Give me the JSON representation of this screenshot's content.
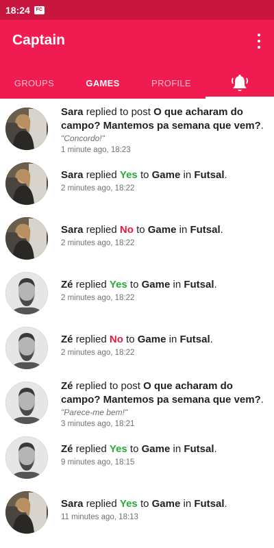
{
  "status_bar": {
    "time": "18:24",
    "notif_label": "FC"
  },
  "app_bar": {
    "title": "Captain"
  },
  "tabs": [
    {
      "label": "GROUPS"
    },
    {
      "label": "GAMES"
    },
    {
      "label": "PROFILE"
    },
    {
      "label": "",
      "icon": "bell-icon"
    }
  ],
  "notifications": [
    {
      "user": "Sara",
      "pre": " replied to post ",
      "post": "O que acharam do campo? Mantemos pa semana que vem?",
      "tail": ".",
      "quote": "\"Concordo!\"",
      "time": "1 minute ago, 18:23"
    },
    {
      "user": "Sara",
      "pre": " replied ",
      "answer": "Yes",
      "mid": " to ",
      "game": "Game",
      "in": " in ",
      "group": "Futsal",
      "tail": ".",
      "time": "2 minutes ago, 18:22"
    },
    {
      "user": "Sara",
      "pre": " replied ",
      "answer": "No",
      "mid": " to ",
      "game": "Game",
      "in": " in ",
      "group": "Futsal",
      "tail": ".",
      "time": "2 minutes ago, 18:22"
    },
    {
      "user": "Zé",
      "pre": " replied ",
      "answer": "Yes",
      "mid": " to ",
      "game": "Game",
      "in": " in ",
      "group": "Futsal",
      "tail": ".",
      "time": "2 minutes ago, 18:22"
    },
    {
      "user": "Zé",
      "pre": " replied ",
      "answer": "No",
      "mid": " to ",
      "game": "Game",
      "in": " in ",
      "group": "Futsal",
      "tail": ".",
      "time": "2 minutes ago, 18:22"
    },
    {
      "user": "Zé",
      "pre": " replied to post ",
      "post": "O que acharam do campo? Mantemos pa semana que vem?",
      "tail": ".",
      "quote": "\"Parece-me bem!\"",
      "time": "3 minutes ago, 18:21"
    },
    {
      "user": "Zé",
      "pre": " replied ",
      "answer": "Yes",
      "mid": " to ",
      "game": "Game",
      "in": " in ",
      "group": "Futsal",
      "tail": ".",
      "time": "9 minutes ago, 18:15"
    },
    {
      "user": "Sara",
      "pre": " replied ",
      "answer": "Yes",
      "mid": " to ",
      "game": "Game",
      "in": " in ",
      "group": "Futsal",
      "tail": ".",
      "time": "11 minutes ago, 18:13"
    }
  ],
  "colors": {
    "primary": "#f01b50",
    "status_bar": "#c8163e",
    "yes": "#2aa83a",
    "no": "#e8183c"
  }
}
